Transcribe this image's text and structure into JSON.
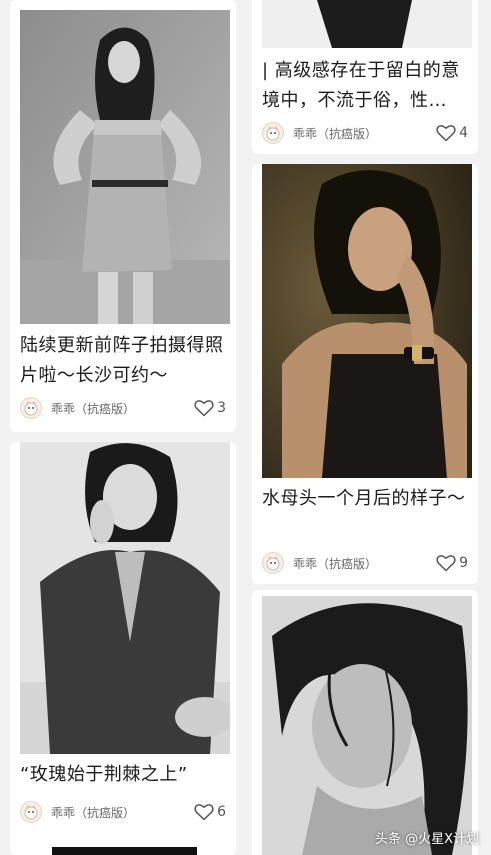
{
  "feed": {
    "left": [
      {
        "title": "陆续更新前阵子拍摄得照片啦～长沙可约～",
        "author": "乖乖（抗癌版）",
        "likes": "3",
        "photo_icon": "photo-bw-woman-standing"
      },
      {
        "title": "“玫瑰始于荆棘之上”",
        "author": "乖乖（抗癌版）",
        "likes": "6",
        "photo_icon": "photo-bw-woman-blazer"
      }
    ],
    "right": [
      {
        "title": "| 高级感存在于留白的意境中，不流于俗，性…",
        "author": "乖乖（抗癌版）",
        "likes": "4",
        "photo_icon": "photo-cropped-top"
      },
      {
        "title": "水母头一个月后的样子～",
        "author": "乖乖（抗癌版）",
        "likes": "9",
        "photo_icon": "photo-color-woman-watch"
      },
      {
        "photo_icon": "photo-bw-woman-closeup"
      }
    ]
  },
  "watermark": "头条 @火星X计划",
  "icons": {
    "like": "heart-outline-icon",
    "avatar": "cartoon-avatar-icon"
  },
  "colors": {
    "background": "#f2f2f2",
    "card": "#ffffff",
    "title_text": "#1c1c1c",
    "meta_text": "#666666"
  }
}
